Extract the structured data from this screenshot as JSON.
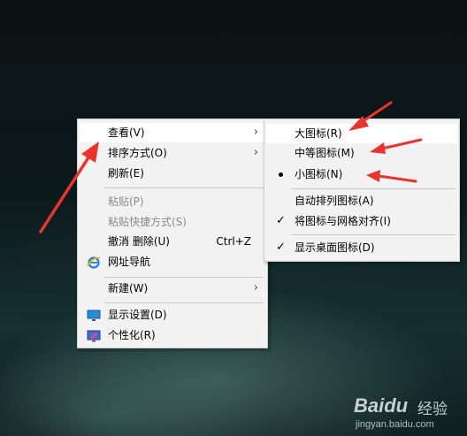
{
  "main_menu": {
    "items": [
      {
        "label": "查看(V)",
        "submenu": true
      },
      {
        "label": "排序方式(O)",
        "submenu": true
      },
      {
        "label": "刷新(E)"
      },
      {
        "label": "粘贴(P)",
        "disabled": true
      },
      {
        "label": "粘贴快捷方式(S)",
        "disabled": true
      },
      {
        "label": "撤消 删除(U)",
        "shortcut": "Ctrl+Z"
      },
      {
        "label": "网址导航",
        "icon": "ie-icon"
      },
      {
        "label": "新建(W)",
        "submenu": true
      },
      {
        "label": "显示设置(D)",
        "icon": "display-settings-icon"
      },
      {
        "label": "个性化(R)",
        "icon": "personalize-icon"
      }
    ]
  },
  "view_submenu": {
    "items": [
      {
        "label": "大图标(R)"
      },
      {
        "label": "中等图标(M)"
      },
      {
        "label": "小图标(N)",
        "selected": true
      },
      {
        "label": "自动排列图标(A)"
      },
      {
        "label": "将图标与网格对齐(I)",
        "checked": true
      },
      {
        "label": "显示桌面图标(D)",
        "checked": true
      }
    ]
  },
  "watermark": {
    "brand": "Baidu",
    "sub": "经验",
    "url": "jingyan.baidu.com"
  },
  "colors": {
    "arrow": "#e8342c",
    "menu_bg": "#f2f2f2",
    "disabled_text": "#8a8a8a"
  }
}
